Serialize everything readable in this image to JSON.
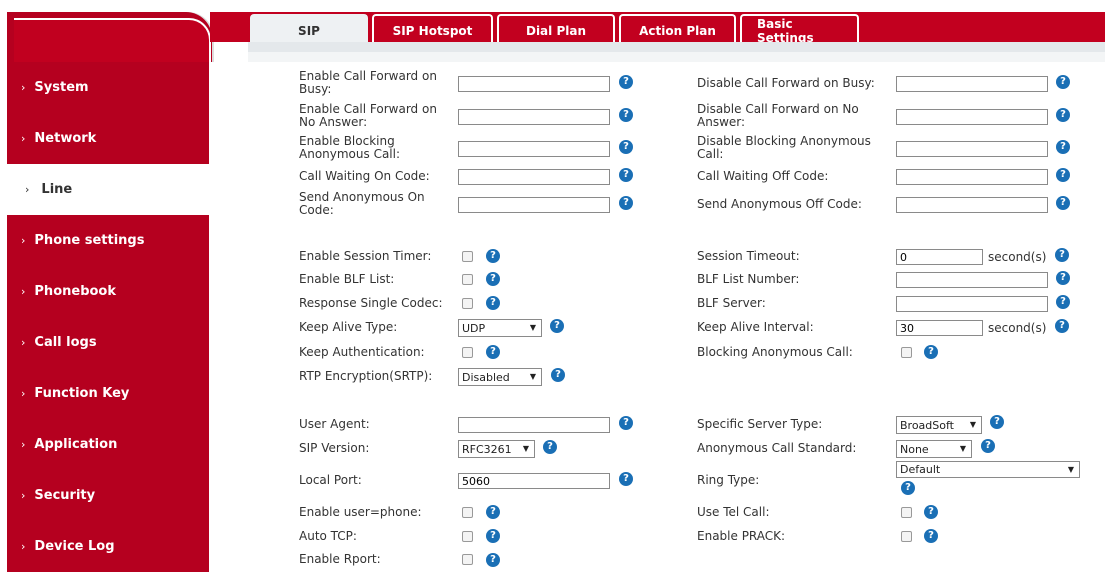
{
  "sidebar": {
    "items": [
      {
        "label": "System",
        "active": false
      },
      {
        "label": "Network",
        "active": false
      },
      {
        "label": "Line",
        "active": true
      },
      {
        "label": "Phone settings",
        "active": false
      },
      {
        "label": "Phonebook",
        "active": false
      },
      {
        "label": "Call logs",
        "active": false
      },
      {
        "label": "Function Key",
        "active": false
      },
      {
        "label": "Application",
        "active": false
      },
      {
        "label": "Security",
        "active": false
      },
      {
        "label": "Device Log",
        "active": false
      }
    ]
  },
  "tabs": [
    "SIP",
    "SIP Hotspot",
    "Dial Plan",
    "Action Plan",
    "Basic Settings"
  ],
  "active_tab": "SIP",
  "form": {
    "call_forward_busy_on": "Enable Call Forward on Busy:",
    "call_forward_busy_off": "Disable Call Forward on Busy:",
    "call_forward_noanswer_on": "Enable Call Forward on No Answer:",
    "call_forward_noanswer_off": "Disable Call Forward on No Answer:",
    "blocking_anon_on": "Enable Blocking Anonymous Call:",
    "blocking_anon_off": "Disable Blocking Anonymous Call:",
    "call_waiting_on": "Call Waiting On Code:",
    "call_waiting_off": "Call Waiting Off Code:",
    "send_anon_on": "Send Anonymous On Code:",
    "send_anon_off": "Send Anonymous Off Code:",
    "session_timer": "Enable Session Timer:",
    "session_timeout": "Session Timeout:",
    "session_timeout_value": "0",
    "blf_list": "Enable BLF List:",
    "blf_list_number": "BLF List Number:",
    "response_single_codec": "Response Single Codec:",
    "blf_server": "BLF Server:",
    "keep_alive_type": "Keep Alive Type:",
    "keep_alive_type_value": "UDP",
    "keep_alive_interval": "Keep Alive Interval:",
    "keep_alive_interval_value": "30",
    "keep_authentication": "Keep Authentication:",
    "blocking_anon_call": "Blocking Anonymous Call:",
    "rtp_encryption": "RTP Encryption(SRTP):",
    "rtp_encryption_value": "Disabled",
    "user_agent": "User Agent:",
    "specific_server_type": "Specific Server Type:",
    "specific_server_type_value": "BroadSoft",
    "sip_version": "SIP Version:",
    "sip_version_value": "RFC3261",
    "anon_call_standard": "Anonymous Call Standard:",
    "anon_call_standard_value": "None",
    "local_port": "Local Port:",
    "local_port_value": "5060",
    "ring_type": "Ring Type:",
    "ring_type_value": "Default",
    "enable_user_phone": "Enable user=phone:",
    "use_tel_call": "Use Tel Call:",
    "auto_tcp": "Auto TCP:",
    "enable_prack": "Enable PRACK:",
    "enable_rport": "Enable Rport:",
    "unit_seconds": "second(s)",
    "help_glyph": "?"
  }
}
